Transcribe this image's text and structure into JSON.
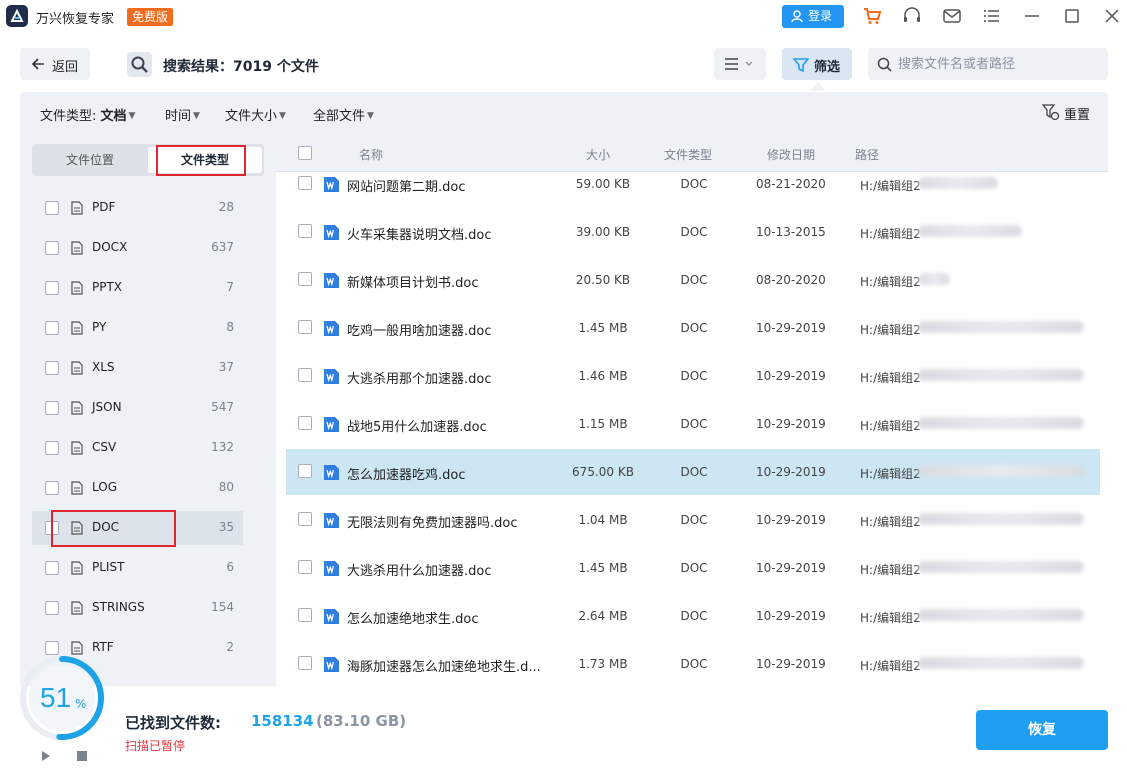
{
  "app": {
    "title": "万兴恢复专家",
    "badge": "免费版",
    "login_label": "登录",
    "colors": {
      "accent": "#1e9ff2",
      "badge": "#f36b1c",
      "highlight": "#e0262c"
    }
  },
  "titlebar_icons": [
    "cart-icon",
    "headset-icon",
    "mail-icon",
    "menu-icon",
    "minimize-icon",
    "maximize-icon",
    "close-icon"
  ],
  "toolbar": {
    "back_label": "返回",
    "search_result": "搜索结果：7019 个文件",
    "filter_label": "筛选",
    "search_placeholder": "搜索文件名或者路径"
  },
  "filter_bar": {
    "file_type_label": "文件类型:",
    "file_type_value": "文档",
    "time": "时间",
    "size": "文件大小",
    "all_files": "全部文件",
    "reset": "重置"
  },
  "sidebar": {
    "tab_location": "文件位置",
    "tab_type": "文件类型",
    "items": [
      {
        "name": "PDF",
        "count": "28"
      },
      {
        "name": "DOCX",
        "count": "637"
      },
      {
        "name": "PPTX",
        "count": "7"
      },
      {
        "name": "PY",
        "count": "8"
      },
      {
        "name": "XLS",
        "count": "37"
      },
      {
        "name": "JSON",
        "count": "547"
      },
      {
        "name": "CSV",
        "count": "132"
      },
      {
        "name": "LOG",
        "count": "80"
      },
      {
        "name": "DOC",
        "count": "35"
      },
      {
        "name": "PLIST",
        "count": "6"
      },
      {
        "name": "STRINGS",
        "count": "154"
      },
      {
        "name": "RTF",
        "count": "2"
      }
    ]
  },
  "table": {
    "headers": {
      "name": "名称",
      "size": "大小",
      "type": "文件类型",
      "date": "修改日期",
      "path": "路径"
    },
    "rows": [
      {
        "name": "网站问题第二期.doc",
        "size": "59.00 KB",
        "type": "DOC",
        "date": "08-21-2020",
        "path": "H:/编辑组2"
      },
      {
        "name": "火车采集器说明文档.doc",
        "size": "39.00 KB",
        "type": "DOC",
        "date": "10-13-2015",
        "path": "H:/编辑组2"
      },
      {
        "name": "新媒体项目计划书.doc",
        "size": "20.50 KB",
        "type": "DOC",
        "date": "08-20-2020",
        "path": "H:/编辑组2"
      },
      {
        "name": "吃鸡一般用啥加速器.doc",
        "size": "1.45 MB",
        "type": "DOC",
        "date": "10-29-2019",
        "path": "H:/编辑组2"
      },
      {
        "name": "大逃杀用那个加速器.doc",
        "size": "1.46 MB",
        "type": "DOC",
        "date": "10-29-2019",
        "path": "H:/编辑组2"
      },
      {
        "name": "战地5用什么加速器.doc",
        "size": "1.15 MB",
        "type": "DOC",
        "date": "10-29-2019",
        "path": "H:/编辑组2"
      },
      {
        "name": "怎么加速器吃鸡.doc",
        "size": "675.00 KB",
        "type": "DOC",
        "date": "10-29-2019",
        "path": "H:/编辑组2"
      },
      {
        "name": "无限法则有免费加速器吗.doc",
        "size": "1.04 MB",
        "type": "DOC",
        "date": "10-29-2019",
        "path": "H:/编辑组2"
      },
      {
        "name": "大逃杀用什么加速器.doc",
        "size": "1.45 MB",
        "type": "DOC",
        "date": "10-29-2019",
        "path": "H:/编辑组2"
      },
      {
        "name": "怎么加速绝地求生.doc",
        "size": "2.64 MB",
        "type": "DOC",
        "date": "10-29-2019",
        "path": "H:/编辑组2"
      },
      {
        "name": "海豚加速器怎么加速绝地求生.d...",
        "size": "1.73 MB",
        "type": "DOC",
        "date": "10-29-2019",
        "path": "H:/编辑组2"
      }
    ]
  },
  "status": {
    "progress_value": "51",
    "progress_unit": "%",
    "found_label": "已找到文件数:",
    "found_count": "158134",
    "found_size": "(83.10 GB)",
    "scan_status": "扫描已暂停",
    "recover_label": "恢复"
  }
}
